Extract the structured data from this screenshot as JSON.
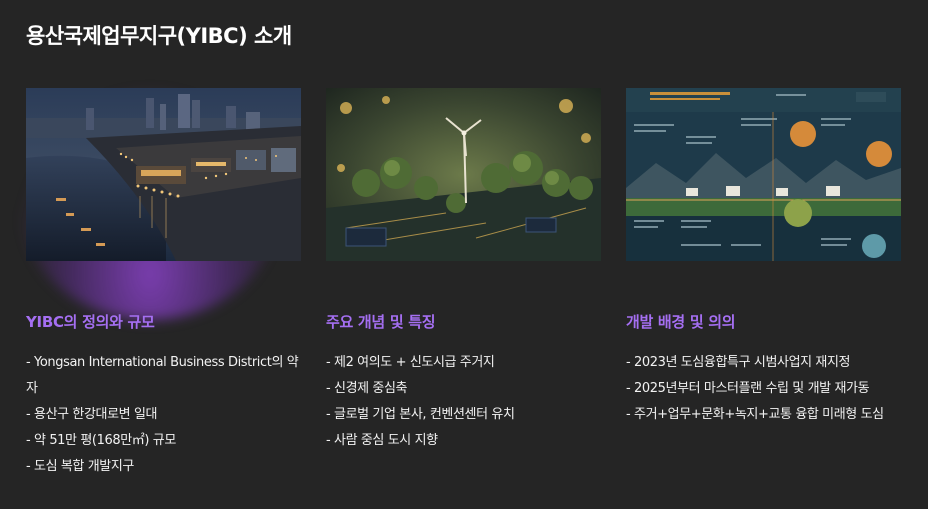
{
  "page": {
    "title": "용산국제업무지구(YIBC) 소개"
  },
  "cards": [
    {
      "heading": "YIBC의 정의와 규모",
      "image_desc": "city-night-riverside-icon",
      "items": [
        "- Yongsan International Business District의 약자",
        "- 용산구 한강대로변 일대",
        "- 약 51만 평(168만㎡) 규모",
        "- 도심 복합 개발지구"
      ]
    },
    {
      "heading": "주요 개념 및 특징",
      "image_desc": "green-tech-city-icon",
      "items": [
        "- 제2 여의도 + 신도시급 주거지",
        "- 신경제 중심축",
        "- 글로벌 기업 본사, 컨벤션센터 유치",
        "- 사람 중심 도시 지향"
      ]
    },
    {
      "heading": "개발 배경 및 의의",
      "image_desc": "infographic-landscape-icon",
      "items": [
        "- 2023년 도심융합특구 시범사업지 재지정",
        "- 2025년부터 마스터플랜 수립 및 개발 재가동",
        "- 주거+업무+문화+녹지+교통 융합 미래형 도심"
      ]
    }
  ],
  "colors": {
    "background": "#252525",
    "heading_accent": "#a56ff2",
    "glow": "#9646dc"
  }
}
